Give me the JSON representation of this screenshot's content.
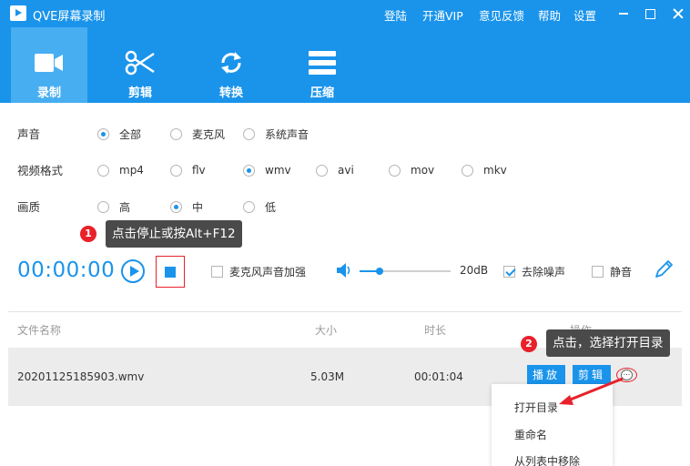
{
  "app": {
    "title": "QVE屏幕录制",
    "top_links": [
      "登陆",
      "开通VIP",
      "意见反馈",
      "帮助",
      "设置"
    ]
  },
  "tabs": [
    {
      "label": "录制",
      "icon": "video-camera-icon",
      "active": true
    },
    {
      "label": "剪辑",
      "icon": "scissors-icon",
      "active": false
    },
    {
      "label": "转换",
      "icon": "convert-arrows-icon",
      "active": false
    },
    {
      "label": "压缩",
      "icon": "compress-icon",
      "active": false
    }
  ],
  "options": {
    "audio": {
      "label": "声音",
      "choices": [
        "全部",
        "麦克风",
        "系统声音"
      ],
      "selected": "全部"
    },
    "format": {
      "label": "视频格式",
      "choices": [
        "mp4",
        "flv",
        "wmv",
        "avi",
        "mov",
        "mkv"
      ],
      "selected": "wmv"
    },
    "quality": {
      "label": "画质",
      "choices": [
        "高",
        "中",
        "低"
      ],
      "selected": "中"
    }
  },
  "tooltips": [
    {
      "number": "1",
      "text": "点击停止或按Alt+F12"
    },
    {
      "number": "2",
      "text": "点击，选择打开目录"
    }
  ],
  "controls": {
    "timer": "00:00:00",
    "mic_boost": {
      "label": "麦克风声音加强",
      "checked": false
    },
    "volume": {
      "level_percent": 22,
      "label": "20dB"
    },
    "denoise": {
      "label": "去除噪声",
      "checked": true
    },
    "mute": {
      "label": "静音",
      "checked": false
    }
  },
  "table": {
    "headers": [
      "文件名称",
      "大小",
      "时长",
      "操作"
    ],
    "rows": [
      {
        "name": "20201125185903.wmv",
        "size": "5.03M",
        "duration": "00:01:04",
        "actions": [
          "播放",
          "剪辑"
        ]
      }
    ]
  },
  "context_menu": {
    "items": [
      "打开目录",
      "重命名",
      "从列表中移除"
    ]
  },
  "colors": {
    "accent": "#1a94eb",
    "active_tab": "#47aef2",
    "badge": "#e8212a",
    "tooltip_bg": "#4a4a4a"
  }
}
